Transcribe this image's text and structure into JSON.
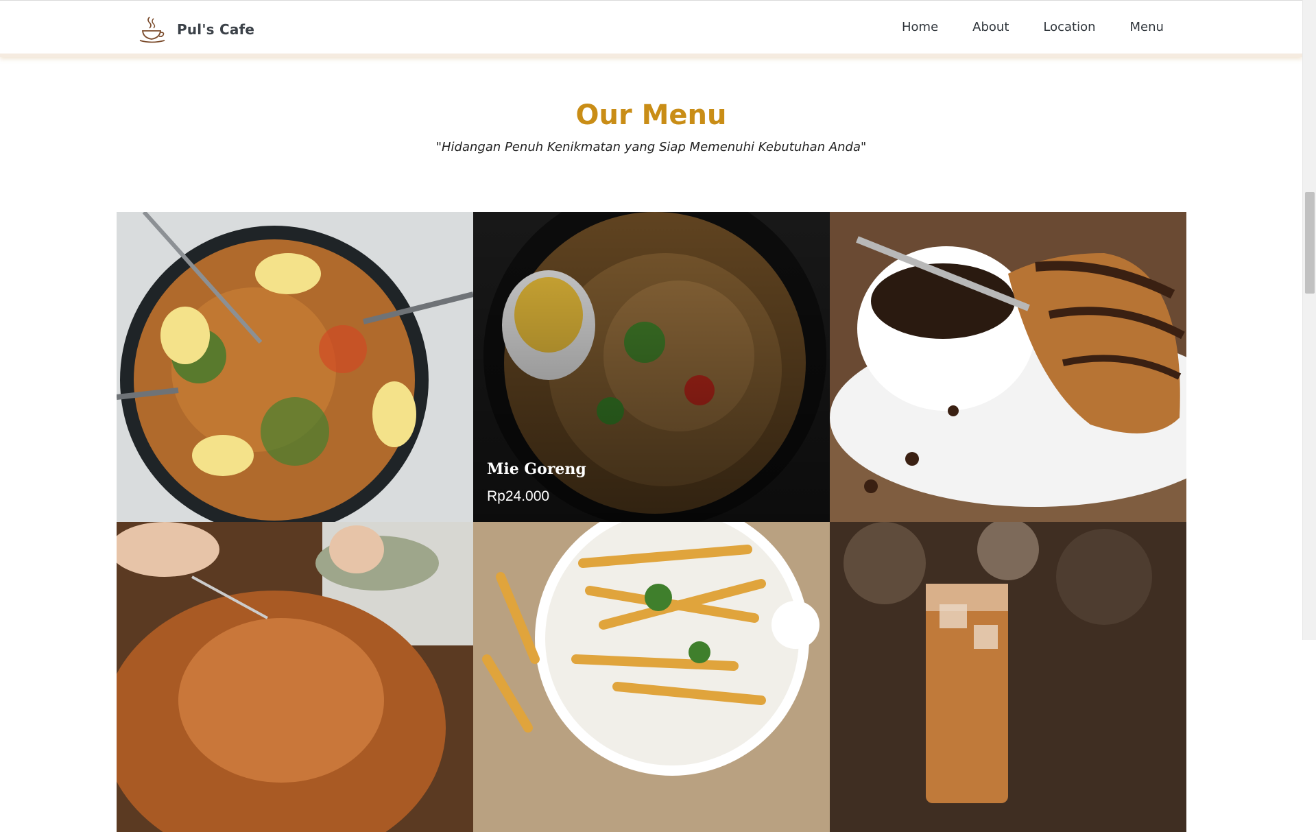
{
  "brand": {
    "name": "Pul's Cafe",
    "logo_icon": "coffee-cup-icon"
  },
  "nav": {
    "links": [
      "Home",
      "About",
      "Location",
      "Menu"
    ]
  },
  "section": {
    "title": "Our Menu",
    "subtitle": "\"Hidangan Penuh Kenikmatan yang Siap Memenuhi Kebutuhan Anda\""
  },
  "menu_items": [
    {
      "name": "",
      "price": "",
      "photo": "fried-rice"
    },
    {
      "name": "Mie Goreng",
      "price": "Rp24.000",
      "photo": "noodles"
    },
    {
      "name": "",
      "price": "",
      "photo": "coffee-croissant"
    },
    {
      "name": "",
      "price": "",
      "photo": "roast-chicken"
    },
    {
      "name": "",
      "price": "",
      "photo": "french-fries"
    },
    {
      "name": "",
      "price": "",
      "photo": "iced-coffee"
    }
  ],
  "colors": {
    "accent": "#c98d16",
    "nav_text": "#2f353b",
    "brand_text": "#3b4148"
  }
}
